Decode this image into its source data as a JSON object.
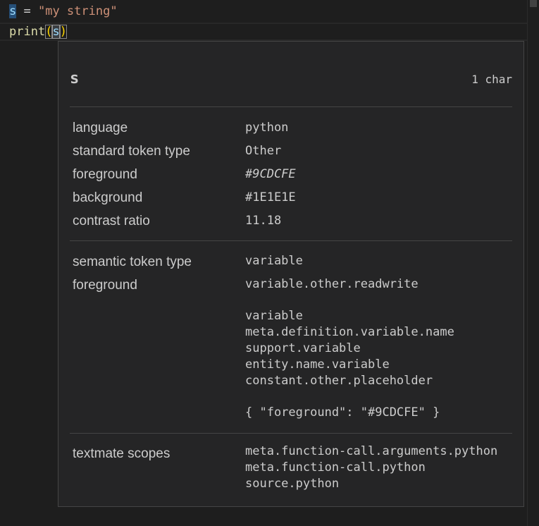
{
  "editor": {
    "line1": {
      "var": "s",
      "op": " = ",
      "str": "\"my string\""
    },
    "line2": {
      "fn": "print",
      "open": "(",
      "arg": "s",
      "close": ")"
    }
  },
  "hover": {
    "title": "s",
    "length": "1 char",
    "token_info": [
      {
        "label": "language",
        "value": "python",
        "italic": false
      },
      {
        "label": "standard token type",
        "value": "Other",
        "italic": false
      },
      {
        "label": "foreground",
        "value": "#9CDCFE",
        "italic": true
      },
      {
        "label": "background",
        "value": "#1E1E1E",
        "italic": false
      },
      {
        "label": "contrast ratio",
        "value": "11.18",
        "italic": false
      }
    ],
    "semantic": {
      "type_label": "semantic token type",
      "type_value": "variable",
      "foreground_label": "foreground",
      "foreground_value": "variable.other.readwrite",
      "rules": [
        "variable",
        "meta.definition.variable.name",
        "support.variable",
        "entity.name.variable",
        "constant.other.placeholder"
      ],
      "style": "{ \"foreground\": \"#9CDCFE\" }"
    },
    "textmate": {
      "label": "textmate scopes",
      "scopes": [
        "meta.function-call.arguments.python",
        "meta.function-call.python",
        "source.python"
      ]
    }
  },
  "colors": {
    "editor_bg": "#1E1E1E",
    "hover_bg": "#252526",
    "variable": "#9CDCFE",
    "string": "#CE9178",
    "function": "#DCDCAA",
    "bracket": "#FFD700"
  }
}
